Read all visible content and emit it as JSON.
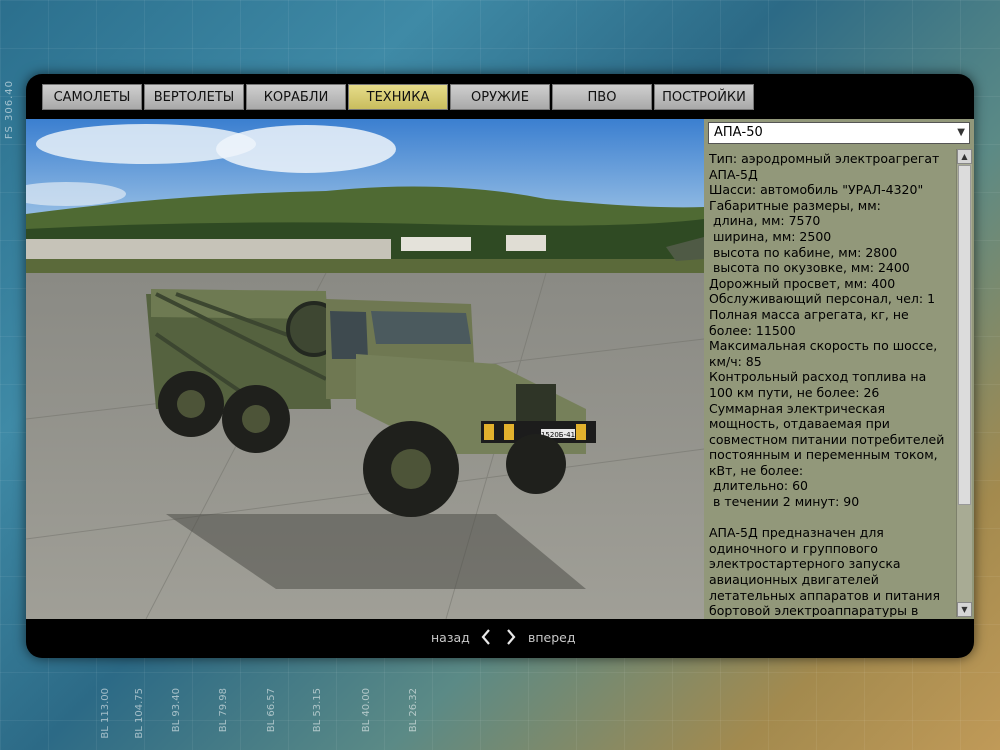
{
  "side_label": "FS 306.40",
  "bl_ticks": [
    "BL 113.00",
    "BL 104.75",
    "BL 93.40",
    "BL 79.98",
    "BL 66.57",
    "BL 53.15",
    "BL 40.00",
    "BL 26.32"
  ],
  "tabs": [
    {
      "label": "САМОЛЕТЫ",
      "active": false
    },
    {
      "label": "ВЕРТОЛЕТЫ",
      "active": false
    },
    {
      "label": "КОРАБЛИ",
      "active": false
    },
    {
      "label": "ТЕХНИКА",
      "active": true
    },
    {
      "label": "ОРУЖИЕ",
      "active": false
    },
    {
      "label": "ПВО",
      "active": false
    },
    {
      "label": "ПОСТРОЙКИ",
      "active": false
    }
  ],
  "viewer": {
    "plate": "1520Б-41"
  },
  "panel": {
    "selected": "АПА-50",
    "description": "Тип: аэродромный электроагрегат АПА-5Д\nШасси: автомобиль \"УРАЛ-4320\"\nГабаритные размеры, мм:\n длина, мм: 7570\n ширина, мм: 2500\n высота по кабине, мм: 2800\n высота по окузовке, мм: 2400\nДорожный просвет, мм: 400\nОбслуживающий персонал, чел: 1\nПолная масса агрегата, кг, не более: 11500\nМаксимальная скорость по шоссе, км/ч: 85\nКонтрольный расход топлива на 100 км пути, не более: 26\nСуммарная электрическая мощность, отдаваемая при совместном питании потребителей постоянным и переменным током, кВт, не более:\n длительно: 60\n в течении 2 минут: 90\n\nАПА-5Д предназначен для одиночного и группового электростартерного запуска авиационных двигателей летательных аппаратов и питания бортовой электроаппаратуры в"
  },
  "nav": {
    "prev_label": "назад",
    "next_label": "вперед"
  },
  "colors": {
    "panel_bg": "#92987a",
    "active_tab": "#e6dc8a",
    "tab": "#c4c4c4"
  }
}
